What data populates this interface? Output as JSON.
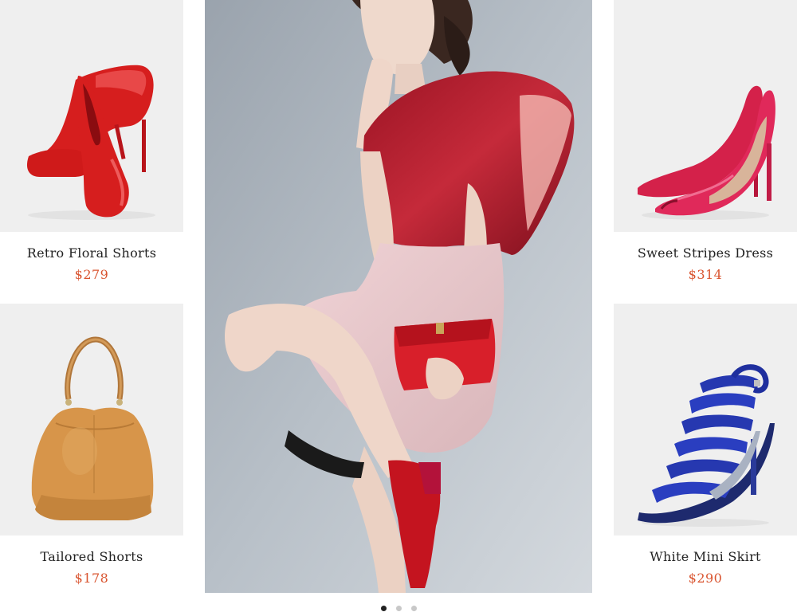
{
  "products": [
    {
      "name": "Retro Floral Shorts",
      "price": "$279",
      "image_icon": "red-pumps-icon"
    },
    {
      "name": "Tailored Shorts",
      "price": "$178",
      "image_icon": "tan-handbag-icon"
    },
    {
      "name": "Sweet Stripes Dress",
      "price": "$314",
      "image_icon": "pink-peeptoe-icon"
    },
    {
      "name": "White Mini Skirt",
      "price": "$290",
      "image_icon": "blue-sandal-icon"
    }
  ],
  "hero": {
    "image_icon": "model-photo"
  },
  "carousel": {
    "page_count": 3,
    "active_index": 0
  },
  "colors": {
    "price": "#d9542f",
    "tile_bg": "#efefef",
    "dot_active": "#222222",
    "dot_inactive": "#c8c8c8"
  }
}
